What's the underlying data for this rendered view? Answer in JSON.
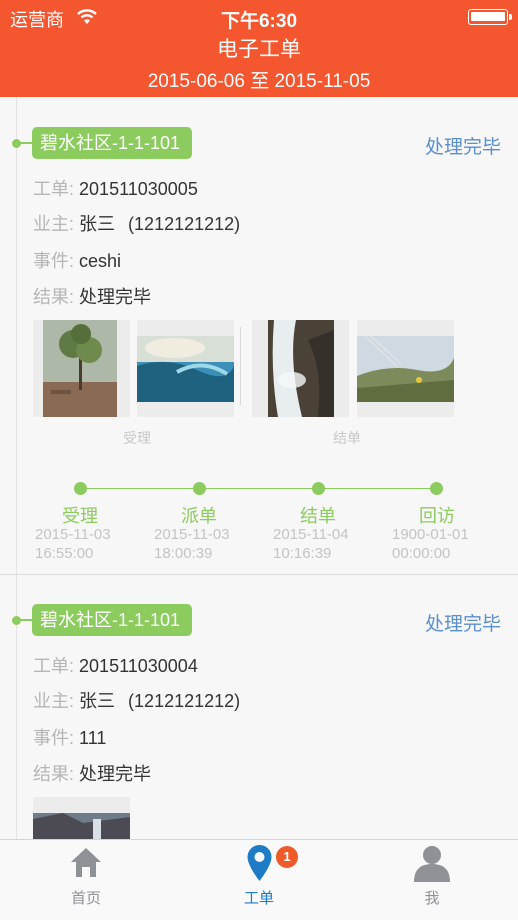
{
  "status_bar": {
    "carrier": "运营商",
    "time": "下午6:30",
    "battery_level": 0.95,
    "wifi_icon": "wifi-icon",
    "battery_icon": "battery-icon"
  },
  "header": {
    "title": "电子工单",
    "date_range": "2015-06-06 至 2015-11-05"
  },
  "labels": {
    "order": "工单:",
    "owner": "业主:",
    "event": "事件:",
    "result": "结果:"
  },
  "orders": [
    {
      "location": "碧水社区-1-1-101",
      "state": "处理完毕",
      "order_no": "201511030005",
      "owner": "张三",
      "phone": "(1212121212)",
      "event": "ceshi",
      "result": "处理完毕",
      "photo_groups": [
        {
          "caption": "受理",
          "photos": [
            "tree-photo",
            "wave-photo"
          ]
        },
        {
          "caption": "结单",
          "photos": [
            "waterfall-photo",
            "grass-photo"
          ]
        }
      ],
      "timeline": [
        {
          "label": "受理",
          "date": "2015-11-03",
          "time": "16:55:00"
        },
        {
          "label": "派单",
          "date": "2015-11-03",
          "time": "18:00:39"
        },
        {
          "label": "结单",
          "date": "2015-11-04",
          "time": "10:16:39"
        },
        {
          "label": "回访",
          "date": "1900-01-01",
          "time": "00:00:00"
        }
      ]
    },
    {
      "location": "碧水社区-1-1-101",
      "state": "处理完毕",
      "order_no": "201511030004",
      "owner": "张三",
      "phone": "(1212121212)",
      "event": "111",
      "result": "处理完毕",
      "photo_groups": [
        {
          "caption": "",
          "photos": [
            "landscape-photo"
          ]
        }
      ]
    }
  ],
  "tabbar": {
    "tabs": [
      {
        "label": "首页",
        "icon": "home-icon",
        "active": false
      },
      {
        "label": "工单",
        "icon": "location-pin-icon",
        "active": true,
        "badge": "1"
      },
      {
        "label": "我",
        "icon": "person-icon",
        "active": false
      }
    ],
    "colors": {
      "active": "#1e7bc6",
      "inactive": "#8e9196",
      "badge": "#f05a28"
    }
  },
  "colors": {
    "header": "#f4562f",
    "tag": "#8ccb5e",
    "state": "#5b8fd0",
    "key_text": "#b6b6b6"
  }
}
